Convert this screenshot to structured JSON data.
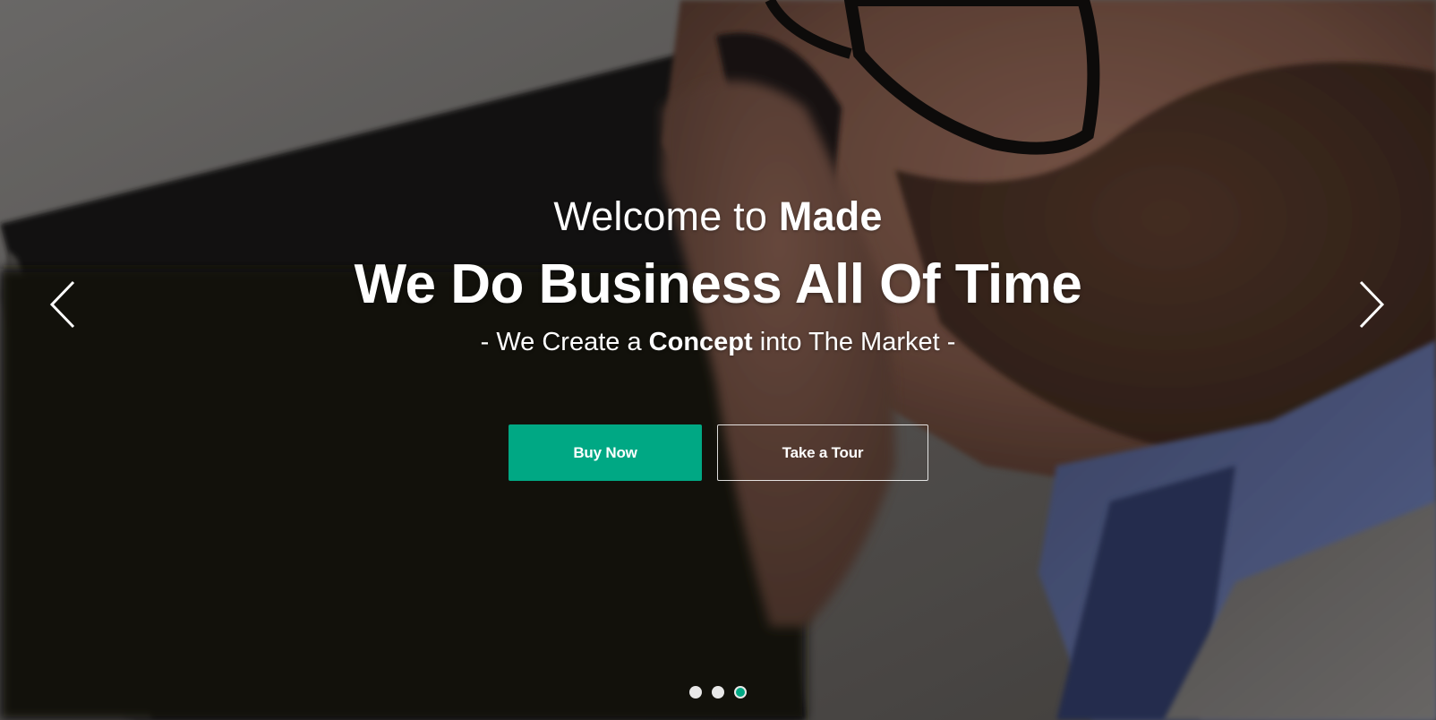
{
  "hero": {
    "welcome_prefix": "Welcome to ",
    "welcome_brand": "Made",
    "headline": "We Do Business All Of Time",
    "tagline_prefix": "- We Create a ",
    "tagline_bold": "Concept",
    "tagline_suffix": " into The Market -"
  },
  "buttons": {
    "primary_label": "Buy Now",
    "secondary_label": "Take a Tour"
  },
  "slider": {
    "slide_count": 3,
    "active_index": 2,
    "prev_icon": "chevron-left-icon",
    "next_icon": "chevron-right-icon"
  },
  "colors": {
    "accent": "#00a884",
    "text": "#ffffff",
    "dot_inactive": "#e8e8e8"
  }
}
